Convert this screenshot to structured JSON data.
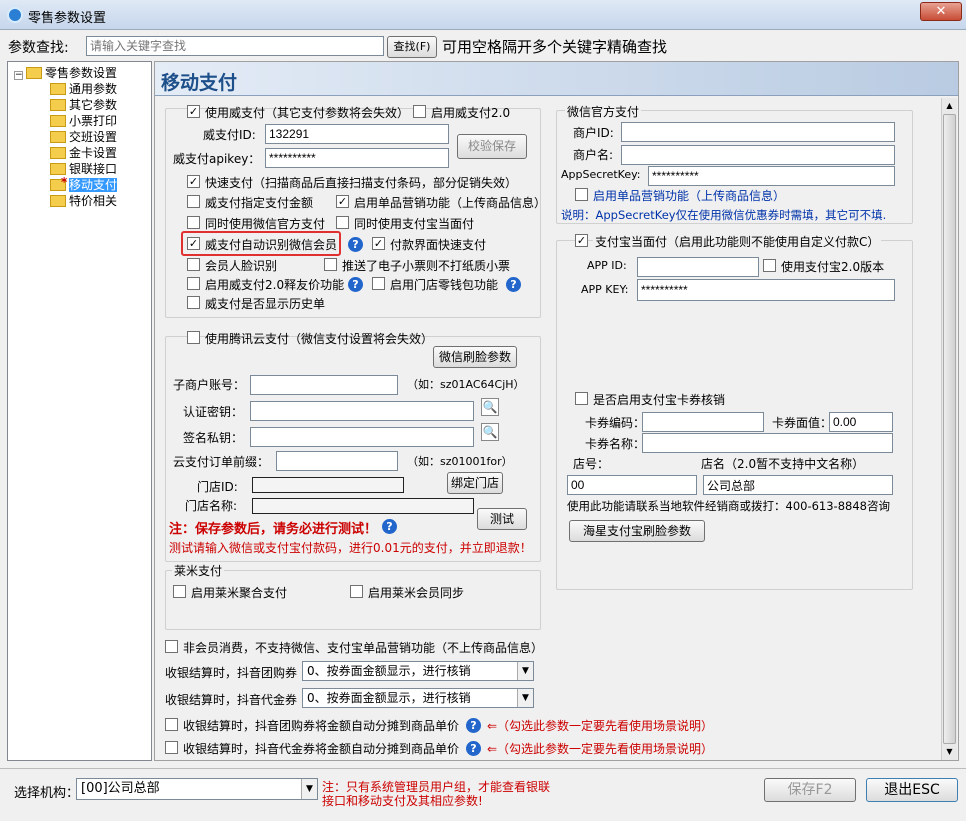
{
  "window": {
    "title": "零售参数设置",
    "close_label": "✕"
  },
  "search": {
    "label": "参数查找:",
    "placeholder": "请输入关键字查找",
    "value": "",
    "button": "查找(F)",
    "hint": "可用空格隔开多个关键字精确查找"
  },
  "tree": {
    "root": "零售参数设置",
    "items": [
      "通用参数",
      "其它参数",
      "小票打印",
      "交班设置",
      "金卡设置",
      "银联接口",
      "移动支付",
      "特价相关"
    ],
    "selected_index": 6,
    "selected_marker": "*"
  },
  "page_title": "移动支付",
  "weizhifu": {
    "use_label": "使用威支付（其它支付参数将会失效）",
    "use_checked": true,
    "v2_label": "启用威支付2.0",
    "v2_checked": false,
    "id_label": "威支付ID:",
    "id_value": "132291",
    "apikey_label": "威支付apikey：",
    "apikey_value": "**********",
    "verify_button": "校验保存",
    "options": [
      {
        "label": "快速支付（扫描商品后直接扫描支付条码，部分促销失效）",
        "checked": true
      },
      {
        "label": "威支付指定支付金额",
        "checked": false
      },
      {
        "label": "启用单品营销功能（上传商品信息）",
        "checked": true
      },
      {
        "label": "同时使用微信官方支付",
        "checked": false
      },
      {
        "label": "同时使用支付宝当面付",
        "checked": false
      },
      {
        "label": "威支付自动识别微信会员",
        "checked": true
      },
      {
        "label": "付款界面快速支付",
        "checked": true
      },
      {
        "label": "会员人脸识别",
        "checked": false
      },
      {
        "label": "推送了电子小票则不打纸质小票",
        "checked": false
      },
      {
        "label": "启用威支付2.0释友价功能",
        "checked": false
      },
      {
        "label": "启用门店零钱包功能",
        "checked": false
      },
      {
        "label": "威支付是否显示历史单",
        "checked": false
      }
    ]
  },
  "tencent": {
    "use_label": "使用腾讯云支付（微信支付设置将会失效）",
    "use_checked": false,
    "face_button": "微信刷脸参数",
    "merchant_label": "子商户账号：",
    "merchant_hint": "（如：sz01AC64CjH）",
    "auth_label": "认证密钥：",
    "sign_label": "签名私钥：",
    "prefix_label": "云支付订单前缀：",
    "prefix_hint": "（如：sz01001for）",
    "store_id_label": "门店ID:",
    "store_name_label": "门店名称:",
    "bind_button": "绑定门店",
    "test_button": "测试",
    "note_title": "注：保存参数后，请务必进行测试！",
    "note_detail": "测试请输入微信或支付宝付款码，进行0.01元的支付，并立即退款！"
  },
  "laimi": {
    "title": "莱米支付",
    "aggregate_label": "启用莱米聚合支付",
    "aggregate_checked": false,
    "member_label": "启用莱米会员同步",
    "member_checked": false
  },
  "wechat_official": {
    "title": "微信官方支付",
    "merchant_id_label": "商户ID:",
    "merchant_name_label": "商户名:",
    "secret_label": "AppSecretKey:",
    "secret_value": "**********",
    "single_label": "启用单品营销功能（上传商品信息）",
    "single_checked": false,
    "note": "说明：AppSecretKey仅在使用微信优惠券时需填，其它可不填."
  },
  "alipay": {
    "title": "支付宝当面付（启用此功能则不能使用自定义付款C）",
    "title_checked": true,
    "appid_label": "APP ID:",
    "v2_label": "使用支付宝2.0版本",
    "v2_checked": false,
    "appkey_label": "APP KEY:",
    "appkey_value": "**********",
    "card_verify_label": "是否启用支付宝卡券核销",
    "card_verify_checked": false,
    "card_code_label": "卡券编码：",
    "card_value_label": "卡券面值：",
    "card_value": "0.00",
    "card_name_label": "卡券名称：",
    "store_no_label": "店号：",
    "store_name_label": "店名（2.0暂不支持中文名称）",
    "store_no_value": "00",
    "store_name_value": "公司总部",
    "contact_note": "使用此功能请联系当地软件经销商或拨打：400-613-8848咨询",
    "face_button": "海星支付宝刷脸参数"
  },
  "bottom_options": {
    "nonmember_label": "非会员消费，不支持微信、支付宝单品营销功能（不上传商品信息）",
    "nonmember_checked": false,
    "group_label": "收银结算时，抖音团购券",
    "group_value": "0、按券面金额显示，进行核销",
    "voucher_label": "收银结算时，抖音代金券",
    "voucher_value": "0、按券面金额显示，进行核销",
    "split_group_label": "收银结算时，抖音团购券将金额自动分摊到商品单价",
    "split_group_checked": false,
    "split_voucher_label": "收银结算时，抖音代金券将金额自动分摊到商品单价",
    "split_voucher_checked": false,
    "warning": "⇐（勾选此参数一定要先看使用场景说明）"
  },
  "footer": {
    "org_label": "选择机构：",
    "org_value": "[00]公司总部",
    "note": "注：只有系统管理员用户组，才能查看银联接口和移动支付及其相应参数!",
    "save_button": "保存F2",
    "exit_button": "退出ESC"
  },
  "colors": {
    "accent": "#1d4f8a",
    "warning": "#cc0000",
    "note_blue": "#0033aa",
    "highlight": "#e03030"
  }
}
